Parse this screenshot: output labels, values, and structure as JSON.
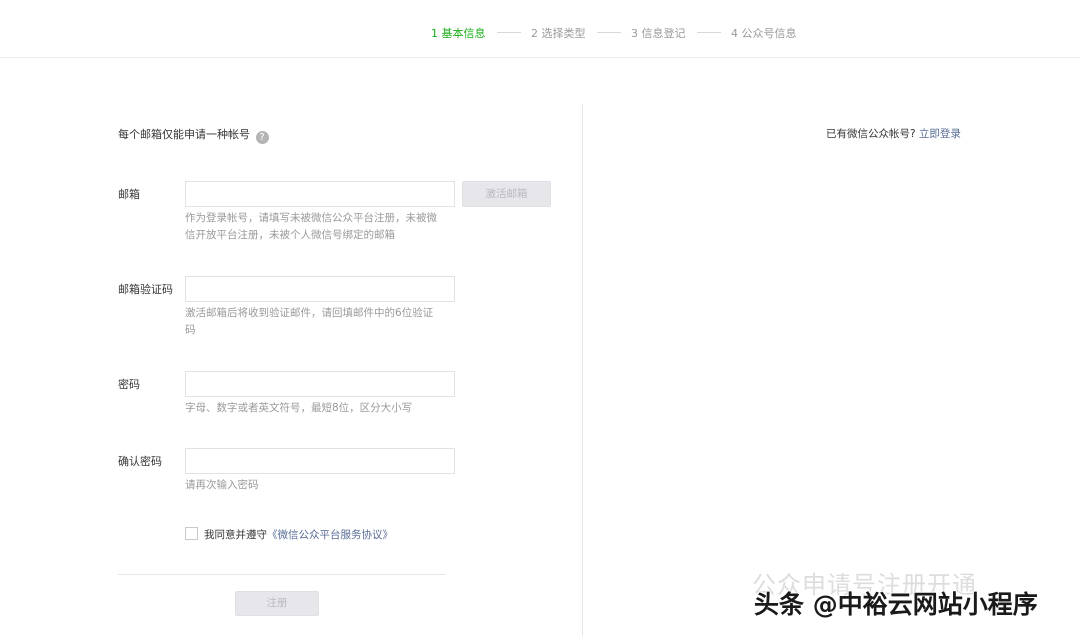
{
  "steps": [
    {
      "label": "1 基本信息",
      "active": true
    },
    {
      "label": "2 选择类型",
      "active": false
    },
    {
      "label": "3 信息登记",
      "active": false
    },
    {
      "label": "4 公众号信息",
      "active": false
    }
  ],
  "form": {
    "notice": "每个邮箱仅能申请一种帐号",
    "help_icon": "question-circle-icon",
    "email": {
      "label": "邮箱",
      "value": "",
      "placeholder": "",
      "activate_button": "激活邮箱",
      "hint": "作为登录帐号，请填写未被微信公众平台注册，未被微信开放平台注册，未被个人微信号绑定的邮箱"
    },
    "code": {
      "label": "邮箱验证码",
      "value": "",
      "placeholder": "",
      "hint": "激活邮箱后将收到验证邮件，请回填邮件中的6位验证码"
    },
    "password": {
      "label": "密码",
      "value": "",
      "placeholder": "",
      "hint": "字母、数字或者英文符号，最短8位，区分大小写"
    },
    "confirm_password": {
      "label": "确认密码",
      "value": "",
      "placeholder": "",
      "hint": "请再次输入密码"
    },
    "agreement": {
      "text": "我同意并遵守",
      "link": "《微信公众平台服务协议》",
      "checked": false
    },
    "register_button": "注册"
  },
  "side": {
    "text": "已有微信公众帐号?",
    "link": "立即登录"
  },
  "watermark": {
    "ghost": "公众申请号注册开通",
    "text": "头条 @中裕云网站小程序"
  },
  "colors": {
    "active_step": "#1aad19",
    "link": "#576b95",
    "disabled_button_bg": "#e7e7eb",
    "hint": "#9a9a9a"
  }
}
